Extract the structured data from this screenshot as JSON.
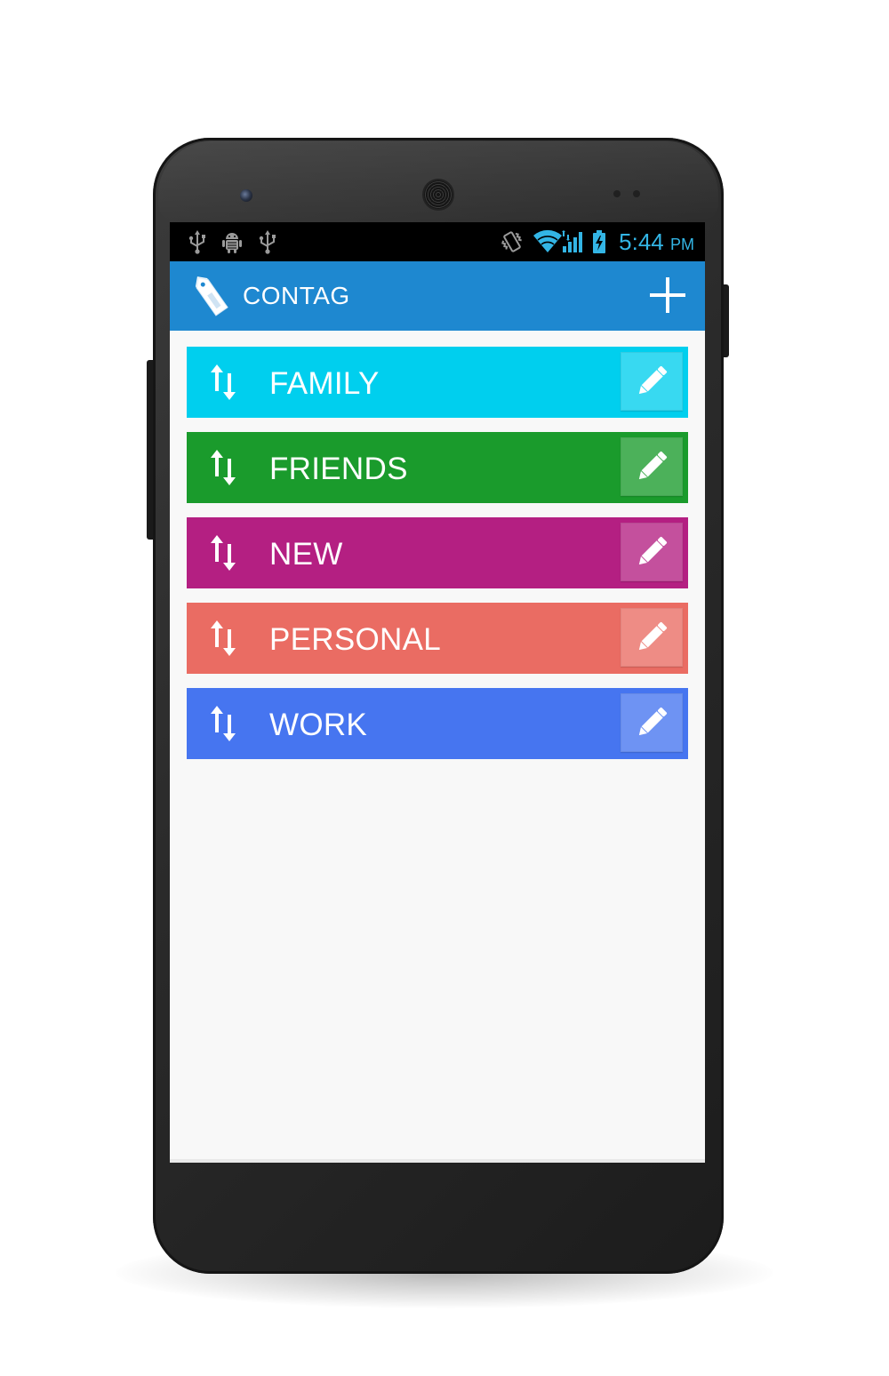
{
  "status_bar": {
    "time": "5:44",
    "ampm": "PM",
    "time_color": "#33b5e5",
    "left_icons": [
      "usb-icon",
      "android-debug-icon",
      "usb-icon"
    ],
    "right_icons": [
      "vibrate-icon",
      "wifi-icon",
      "signal-icon",
      "battery-charging-icon"
    ]
  },
  "action_bar": {
    "title": "CONTAG",
    "logo_icon": "tag-icon",
    "action_icon": "plus-icon",
    "color": "#1e88d0"
  },
  "tags": [
    {
      "label": "FAMILY",
      "color": "#00cfee"
    },
    {
      "label": "FRIENDS",
      "color": "#1a9b2c"
    },
    {
      "label": "NEW",
      "color": "#b41f82"
    },
    {
      "label": "PERSONAL",
      "color": "#ea6c63"
    },
    {
      "label": "WORK",
      "color": "#4675f0"
    }
  ],
  "row_icons": {
    "handle": "reorder-arrows-icon",
    "edit": "pencil-icon"
  }
}
